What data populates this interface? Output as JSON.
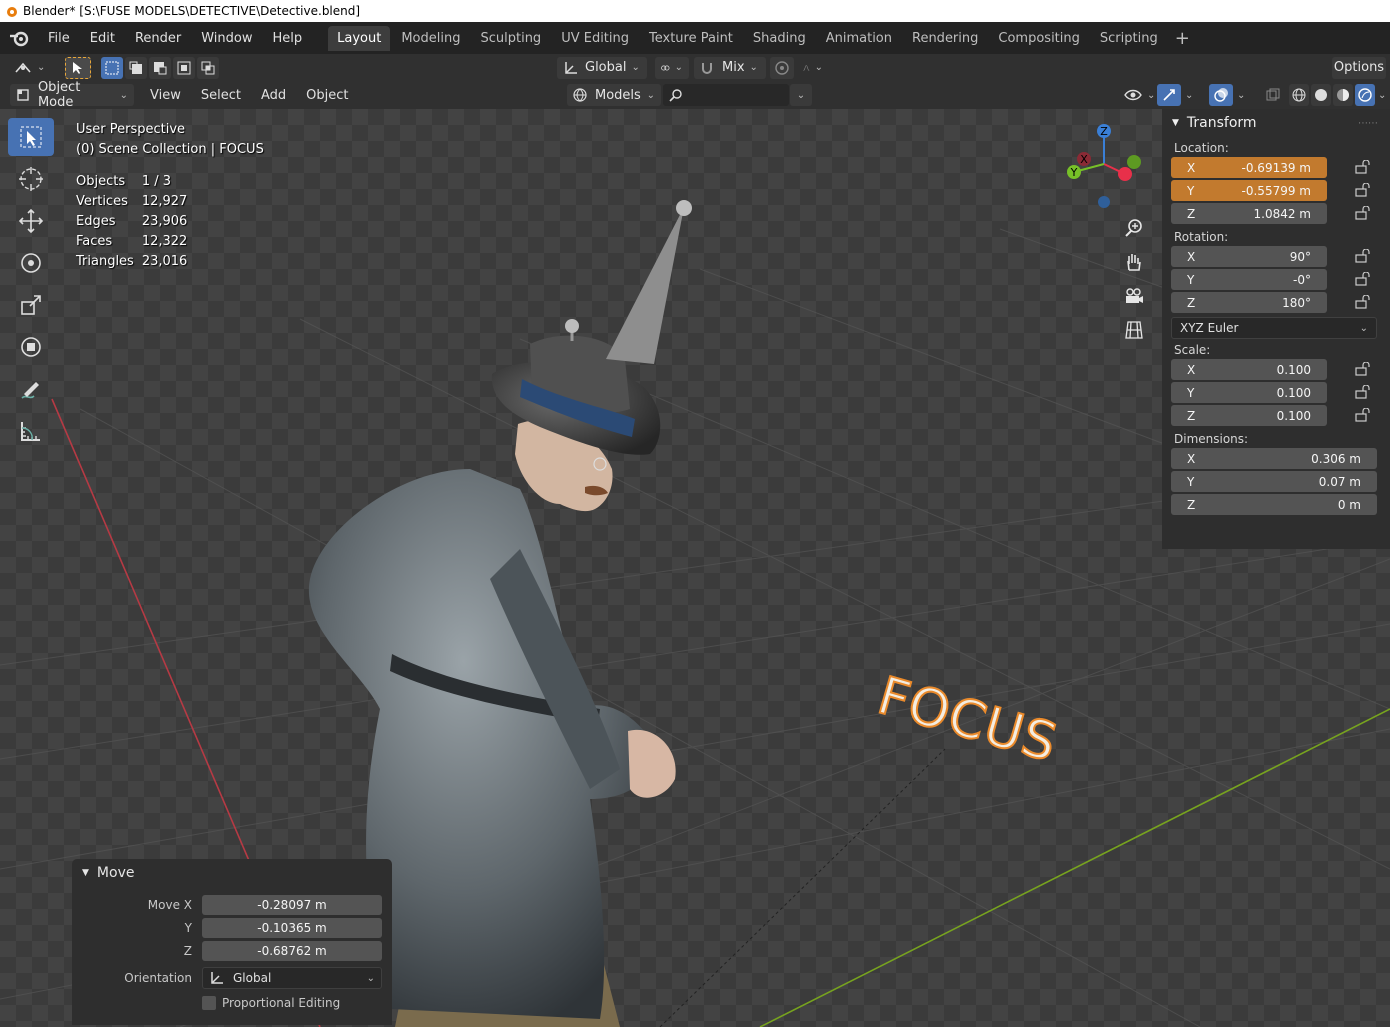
{
  "window": {
    "title": "Blender* [S:\\FUSE MODELS\\DETECTIVE\\Detective.blend]"
  },
  "menu": [
    "File",
    "Edit",
    "Render",
    "Window",
    "Help"
  ],
  "workspaces": [
    "Layout",
    "Modeling",
    "Sculpting",
    "UV Editing",
    "Texture Paint",
    "Shading",
    "Animation",
    "Rendering",
    "Compositing",
    "Scripting"
  ],
  "header": {
    "transform_orientation": "Global",
    "pivot_mode": "Mix",
    "options": "Options",
    "object_mode": "Object Mode",
    "view_menu": [
      "View",
      "Select",
      "Add",
      "Object"
    ],
    "collection": "Models"
  },
  "viewport": {
    "perspective": "User Perspective",
    "scene": "(0) Scene Collection | FOCUS",
    "stats": [
      {
        "label": "Objects",
        "value": "1 / 3"
      },
      {
        "label": "Vertices",
        "value": "12,927"
      },
      {
        "label": "Edges",
        "value": "23,906"
      },
      {
        "label": "Faces",
        "value": "12,322"
      },
      {
        "label": "Triangles",
        "value": "23,016"
      }
    ],
    "text_object": "FOCUS",
    "gizmo": {
      "x": "X",
      "y": "Y",
      "z": "Z"
    }
  },
  "transform": {
    "title": "Transform",
    "location_label": "Location:",
    "location": [
      {
        "axis": "X",
        "value": "-0.69139 m"
      },
      {
        "axis": "Y",
        "value": "-0.55799 m"
      },
      {
        "axis": "Z",
        "value": "1.0842 m"
      }
    ],
    "rotation_label": "Rotation:",
    "rotation": [
      {
        "axis": "X",
        "value": "90°"
      },
      {
        "axis": "Y",
        "value": "-0°"
      },
      {
        "axis": "Z",
        "value": "180°"
      }
    ],
    "rotation_mode": "XYZ Euler",
    "scale_label": "Scale:",
    "scale": [
      {
        "axis": "X",
        "value": "0.100"
      },
      {
        "axis": "Y",
        "value": "0.100"
      },
      {
        "axis": "Z",
        "value": "0.100"
      }
    ],
    "dimensions_label": "Dimensions:",
    "dimensions": [
      {
        "axis": "X",
        "value": "0.306 m"
      },
      {
        "axis": "Y",
        "value": "0.07 m"
      },
      {
        "axis": "Z",
        "value": "0 m"
      }
    ]
  },
  "move_panel": {
    "title": "Move",
    "rows": [
      {
        "label": "Move X",
        "value": "-0.28097 m"
      },
      {
        "label": "Y",
        "value": "-0.10365 m"
      },
      {
        "label": "Z",
        "value": "-0.68762 m"
      }
    ],
    "orientation_label": "Orientation",
    "orientation_value": "Global",
    "proportional_label": "Proportional Editing"
  }
}
